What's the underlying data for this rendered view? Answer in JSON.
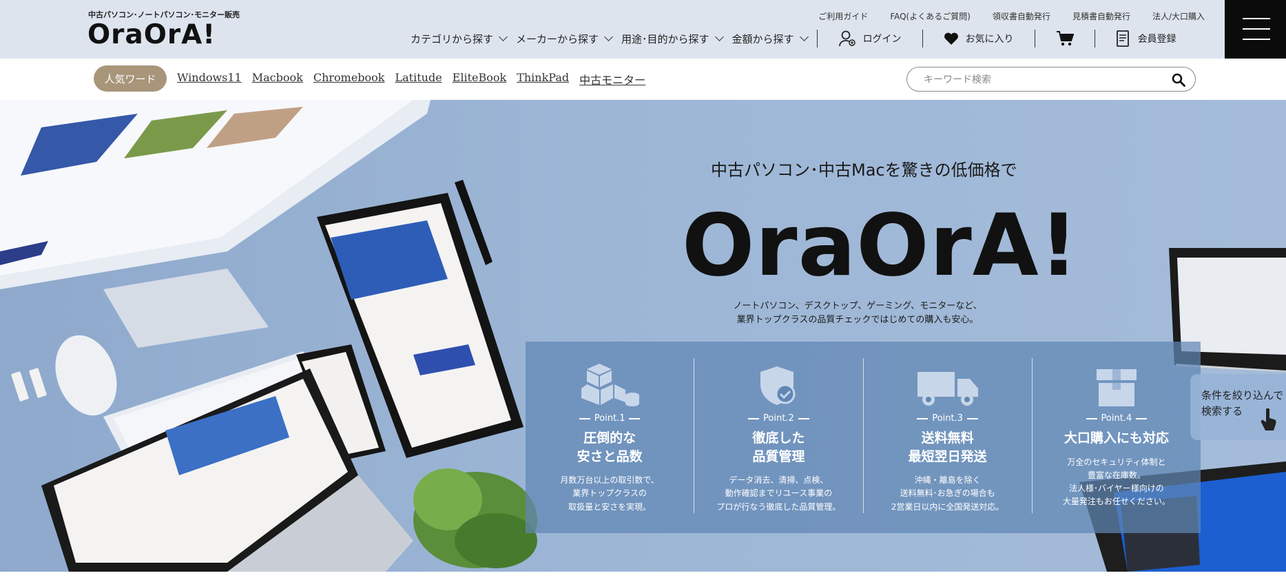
{
  "header": {
    "brand_sub": "中古パソコン･ノートパソコン･モニター販売",
    "brand_logo": "OraOrA!",
    "util_links": [
      "ご利用ガイド",
      "FAQ(よくあるご質問)",
      "領収書自動発行",
      "見積書自動発行",
      "法人/大口購入"
    ],
    "categories": [
      "カテゴリから探す",
      "メーカーから探す",
      "用途･目的から探す",
      "金額から探す"
    ],
    "login": "ログイン",
    "favorites": "お気に入り",
    "register": "会員登録"
  },
  "keywords": {
    "badge": "人気ワード",
    "links": [
      "Windows11",
      "Macbook",
      "Chromebook",
      "Latitude",
      "EliteBook",
      "ThinkPad",
      "中古モニター"
    ],
    "search_placeholder": "キーワード検索"
  },
  "hero": {
    "tagline": "中古パソコン･中古Macを驚きの低価格で",
    "logo": "OraOrA!",
    "desc_line1": "ノートパソコン、デスクトップ、ゲーミング、モニターなど、",
    "desc_line2": "業界トップクラスの品質チェックではじめての購入も安心。",
    "points": [
      {
        "num": "Point.1",
        "title1": "圧倒的な",
        "title2": "安さと品数",
        "body1": "月数万台以上の取引数で、",
        "body2": "業界トップクラスの",
        "body3": "取扱量と安さを実現。",
        "body4": "",
        "icon": "boxes-icon"
      },
      {
        "num": "Point.2",
        "title1": "徹底した",
        "title2": "品質管理",
        "body1": "データ消去、清掃、点検、",
        "body2": "動作確認までリユース事業の",
        "body3": "プロが行なう徹底した品質管理。",
        "body4": "",
        "icon": "shield-check-icon"
      },
      {
        "num": "Point.3",
        "title1": "送料無料",
        "title2": "最短翌日発送",
        "body1": "沖縄・離島を除く",
        "body2": "送料無料･お急ぎの場合も",
        "body3": "2営業日以内に全国発送対応。",
        "body4": "",
        "icon": "truck-icon"
      },
      {
        "num": "Point.4",
        "title1": "大口購入にも対応",
        "title2": "",
        "body1": "万全のセキュリティ体制と",
        "body2": "豊富な在庫数。",
        "body3": "法人様･バイヤー様向けの",
        "body4": "大量発注もお任せください。",
        "icon": "box-icon"
      }
    ],
    "filter_line1": "条件を絞り込んで",
    "filter_line2": "検索する"
  },
  "colors": {
    "header_bg": "#dde4ee",
    "badge_bg": "#a8957a",
    "hero_bg": "#9db6d6",
    "points_bg": "#6086b4",
    "menu_bg": "#0b0b0b"
  }
}
